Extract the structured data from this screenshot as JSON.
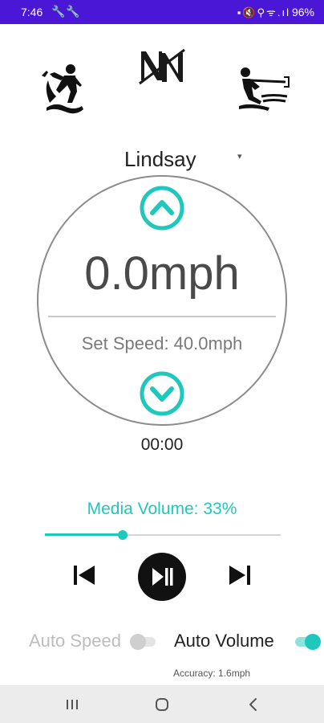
{
  "status_bar": {
    "time": "7:46",
    "left_icons": "🔧🔧",
    "right_icons": "▪🔇⚲ᯤ.ıl",
    "battery": "96%",
    "background": "#4a17d6"
  },
  "header": {
    "left_icon": "wakesurf-rider-icon",
    "logo": "nn-logo",
    "right_icon": "wakeboard-skier-icon"
  },
  "profile": {
    "name": "Lindsay",
    "caret": "▾"
  },
  "speed": {
    "value": "0.0mph",
    "set_speed": "Set Speed: 40.0mph",
    "up_icon": "chevron-up-icon",
    "down_icon": "chevron-down-icon"
  },
  "timer": "00:00",
  "media": {
    "volume_label": "Media Volume: 33%",
    "volume_fraction": 0.33,
    "prev_icon": "skip-previous-icon",
    "play_pause_icon": "play-pause-icon",
    "next_icon": "skip-next-icon"
  },
  "toggles": {
    "auto_speed": {
      "label": "Auto Speed",
      "on": false
    },
    "auto_volume": {
      "label": "Auto Volume",
      "on": true
    }
  },
  "accuracy": "Accuracy: 1.6mph",
  "nav": {
    "recent": "recent-apps-icon",
    "home": "home-icon",
    "back": "back-icon"
  },
  "colors": {
    "accent": "#1fc7bd",
    "dial_border": "#8c8c8c",
    "text": "#222222",
    "muted": "#7a7a7a"
  }
}
